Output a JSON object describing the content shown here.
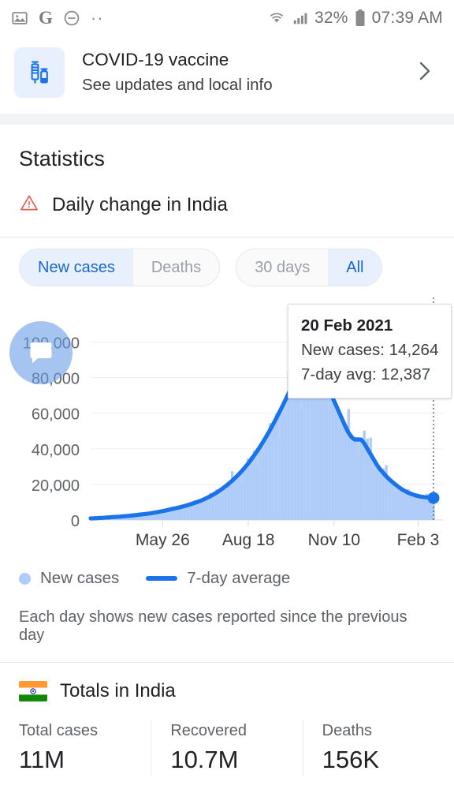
{
  "statusbar": {
    "icons": [
      "image-icon",
      "google-icon",
      "do-not-disturb-icon",
      "more-dots-icon",
      "wifi-icon",
      "signal-icon",
      "battery-icon"
    ],
    "google_glyph": "G",
    "dots_glyph": "··",
    "battery_percent": "32%",
    "time": "07:39 AM"
  },
  "vaccine_card": {
    "title": "COVID-19 vaccine",
    "subtitle": "See updates and local info",
    "chevron": "›"
  },
  "statistics": {
    "heading": "Statistics",
    "daily_change_label": "Daily change in India",
    "warning_icon": "warning-triangle-icon",
    "warning_color": "#d93025"
  },
  "chips": {
    "metric": [
      {
        "label": "New cases",
        "active": true
      },
      {
        "label": "Deaths",
        "active": false
      }
    ],
    "range": [
      {
        "label": "30 days",
        "active": false
      },
      {
        "label": "All",
        "active": true
      }
    ]
  },
  "fab": {
    "icon": "chat-bubble-icon",
    "color": "#6699e6"
  },
  "tooltip": {
    "date": "20 Feb 2021",
    "new_cases": "New cases: 14,264",
    "seven_day_avg": "7-day avg: 12,387"
  },
  "legend": [
    {
      "label": "New cases",
      "marker": "dot",
      "color": "#aecbfa"
    },
    {
      "label": "7-day average",
      "marker": "line",
      "color": "#1a73e8"
    }
  ],
  "footnote": "Each day shows new cases reported since the previous day",
  "totals": {
    "heading": "Totals in India",
    "flag_icon": "india-flag-icon",
    "cells": [
      {
        "label": "Total cases",
        "value": "11M"
      },
      {
        "label": "Recovered",
        "value": "10.7M"
      },
      {
        "label": "Deaths",
        "value": "156K"
      }
    ]
  },
  "chart_data": {
    "type": "area",
    "title": "Daily change in India",
    "xlabel": "",
    "ylabel": "",
    "ylim": [
      0,
      110000
    ],
    "yticks": [
      0,
      20000,
      40000,
      60000,
      80000,
      100000
    ],
    "ytick_labels": [
      "0",
      "20,000",
      "40,000",
      "60,000",
      "80,000",
      "100,000"
    ],
    "xtick_labels": [
      "May 26",
      "Aug 18",
      "Nov 10",
      "Feb 3"
    ],
    "xtick_positions": [
      0.21,
      0.46,
      0.71,
      0.955
    ],
    "grid": true,
    "legend_position": "bottom-left",
    "highlight_marker": {
      "x": 1.0,
      "y": 12387,
      "label": "20 Feb 2021"
    },
    "series": [
      {
        "name": "New cases",
        "type": "bar",
        "color": "#aecbfa",
        "values": [
          800,
          900,
          1000,
          1100,
          1200,
          1300,
          1500,
          1600,
          1700,
          1800,
          1900,
          2100,
          2200,
          2400,
          2600,
          2800,
          3000,
          3200,
          3400,
          3600,
          3900,
          4200,
          4500,
          4900,
          5200,
          5600,
          6000,
          6400,
          6800,
          7200,
          7700,
          8200,
          8700,
          9300,
          9900,
          10500,
          11200,
          12000,
          12900,
          13800,
          14800,
          15900,
          17100,
          18400,
          19800,
          21300,
          22900,
          24600,
          26400,
          28400,
          30500,
          32700,
          35100,
          37600,
          40200,
          43000,
          45900,
          48900,
          52100,
          55400,
          58800,
          62300,
          65900,
          69600,
          73400,
          77300,
          81200,
          85200,
          89200,
          93200,
          96000,
          97800,
          92000,
          88000,
          83000,
          78000,
          74000,
          70000,
          66000,
          62000,
          58000,
          54000,
          50000,
          47000,
          45500,
          45000,
          46000,
          44000,
          41000,
          38000,
          35000,
          32000,
          29000,
          27000,
          25000,
          23000,
          21500,
          20000,
          18500,
          17000,
          16000,
          15000,
          14500,
          14000,
          13500,
          13000,
          12800,
          12600,
          12400,
          14264
        ]
      },
      {
        "name": "7-day average",
        "type": "line",
        "color": "#1a73e8",
        "values": [
          900,
          950,
          1050,
          1150,
          1250,
          1400,
          1500,
          1650,
          1750,
          1850,
          2000,
          2150,
          2300,
          2500,
          2700,
          2900,
          3100,
          3300,
          3500,
          3750,
          4050,
          4350,
          4700,
          5050,
          5400,
          5800,
          6200,
          6600,
          7000,
          7450,
          7950,
          8450,
          9000,
          9600,
          10200,
          10850,
          11600,
          12450,
          13350,
          14300,
          15350,
          16500,
          17750,
          19100,
          20550,
          22100,
          23750,
          25500,
          27400,
          29450,
          31600,
          33900,
          36350,
          38900,
          41600,
          44450,
          47400,
          50500,
          53750,
          57100,
          60550,
          64100,
          67750,
          71500,
          75350,
          79250,
          83200,
          87200,
          91150,
          92800,
          93000,
          91000,
          88500,
          85500,
          81500,
          77000,
          72500,
          68500,
          64500,
          60500,
          56500,
          52500,
          49000,
          46500,
          45200,
          45300,
          45200,
          43000,
          40000,
          37000,
          34000,
          31000,
          28500,
          26500,
          24500,
          22800,
          21200,
          19800,
          18400,
          17200,
          16200,
          15300,
          14600,
          14000,
          13500,
          13100,
          12900,
          12700,
          12500,
          12387
        ]
      }
    ]
  }
}
